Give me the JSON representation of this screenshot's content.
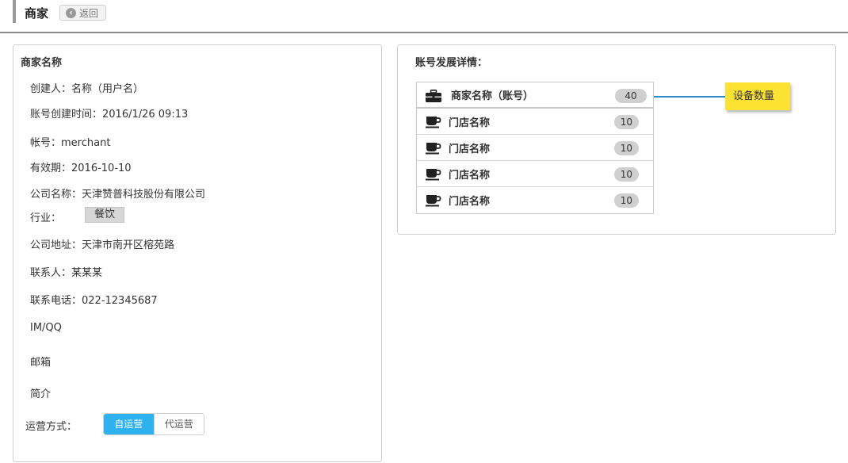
{
  "header": {
    "title": "商家",
    "back_label": "返回"
  },
  "merchant": {
    "section_title": "商家名称",
    "creator": "创建人：名称（用户名）",
    "created_at": "账号创建时间：2016/1/26 09:13",
    "account": "帐号：merchant",
    "validity": "有效期：2016-10-10",
    "company": "公司名称：天津赞普科技股份有限公司",
    "industry_label": "行业：",
    "industry_value": "餐饮",
    "address": "公司地址：天津市南开区榕苑路",
    "contact": "联系人：某某某",
    "phone": "联系电话：022-12345687",
    "im": "IM/QQ",
    "email": "邮箱",
    "intro": "简介",
    "operation_label": "运营方式：",
    "operation_options": [
      "自运营",
      "代运营"
    ],
    "operation_selected": "自运营"
  },
  "account_detail": {
    "section_title": "账号发展详情：",
    "merchant_row": {
      "label": "商家名称（账号）",
      "count": "40",
      "icon": "briefcase-icon"
    },
    "stores": [
      {
        "label": "门店名称",
        "count": "10",
        "icon": "coffee-cup-icon"
      },
      {
        "label": "门店名称",
        "count": "10",
        "icon": "coffee-cup-icon"
      },
      {
        "label": "门店名称",
        "count": "10",
        "icon": "coffee-cup-icon"
      },
      {
        "label": "门店名称",
        "count": "10",
        "icon": "coffee-cup-icon"
      }
    ],
    "annotation": "设备数量"
  },
  "colors": {
    "accent_blue": "#2eb1ef",
    "connector": "#2a8fc7",
    "note_yellow": "#fce232"
  }
}
